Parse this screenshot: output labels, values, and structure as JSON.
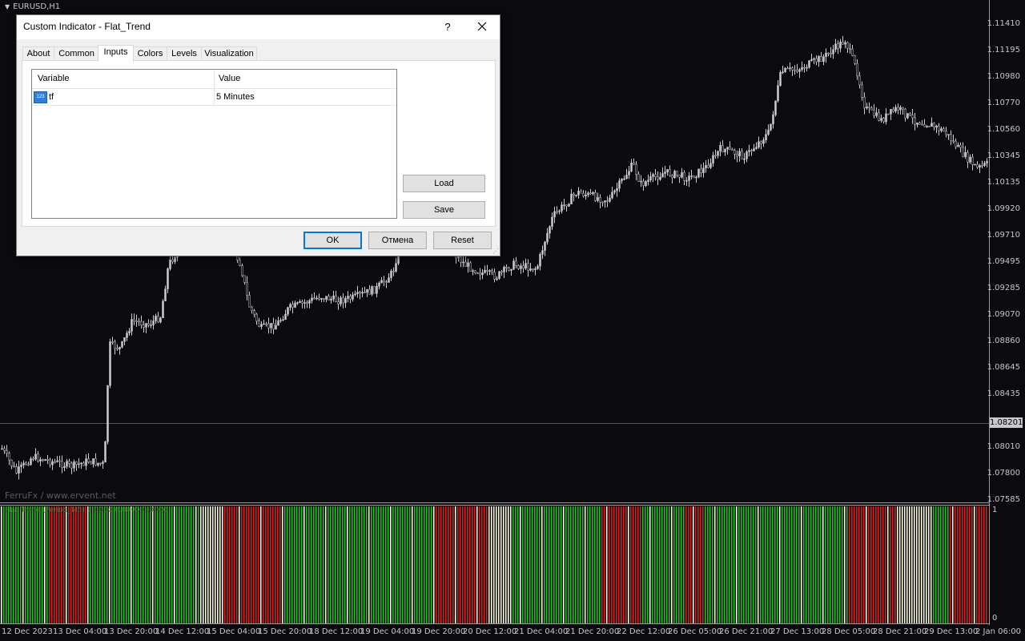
{
  "chart": {
    "symbol_title": "EURUSD,H1",
    "watermark": "FerruFx / www.ervent.net",
    "indicator_label": "Flat Trend (Period_M5) 1.0000 0.0000 0.0000",
    "current_price": "1.08201",
    "price_labels": [
      "1.11410",
      "1.11195",
      "1.10980",
      "1.10770",
      "1.10560",
      "1.10345",
      "1.10135",
      "1.09920",
      "1.09710",
      "1.09495",
      "1.09285",
      "1.09070",
      "1.08860",
      "1.08645",
      "1.08435",
      "1.08010",
      "1.07800",
      "1.07585"
    ],
    "sub_axis": {
      "top": "1",
      "bottom": "0"
    },
    "time_labels": [
      "12 Dec 2023",
      "13 Dec 04:00",
      "13 Dec 20:00",
      "14 Dec 12:00",
      "15 Dec 04:00",
      "15 Dec 20:00",
      "18 Dec 12:00",
      "19 Dec 04:00",
      "19 Dec 20:00",
      "20 Dec 12:00",
      "21 Dec 04:00",
      "21 Dec 20:00",
      "22 Dec 12:00",
      "26 Dec 05:00",
      "26 Dec 21:00",
      "27 Dec 13:00",
      "28 Dec 05:00",
      "28 Dec 21:00",
      "29 Dec 13:00",
      "2 Jan 06:00"
    ],
    "colors": {
      "bull": "#19c519",
      "bear": "#e11e1e",
      "flat": "#ffffe0",
      "candle": "#cccccc"
    }
  },
  "dialog": {
    "title": "Custom Indicator - Flat_Trend",
    "help": "?",
    "tabs": [
      {
        "label": "About"
      },
      {
        "label": "Common"
      },
      {
        "label": "Inputs",
        "active": true
      },
      {
        "label": "Colors"
      },
      {
        "label": "Levels"
      },
      {
        "label": "Visualization"
      }
    ],
    "grid": {
      "col_variable": "Variable",
      "col_value": "Value",
      "rows": [
        {
          "icon": "123",
          "variable": "tf",
          "value": "5 Minutes"
        }
      ]
    },
    "buttons": {
      "load": "Load",
      "save": "Save",
      "ok": "OK",
      "cancel": "Отмена",
      "reset": "Reset"
    }
  }
}
